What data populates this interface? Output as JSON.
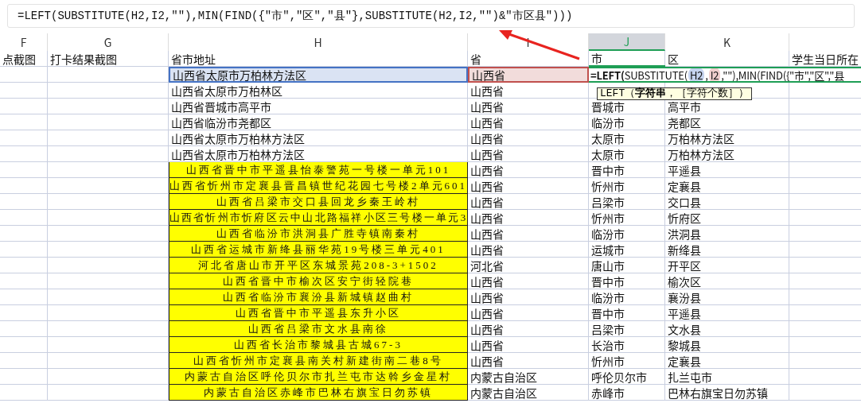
{
  "formula_bar": {
    "text": "=LEFT(SUBSTITUTE(H2,I2,\"\"),MIN(FIND({\"市\",\"区\",\"县\"},SUBSTITUTE(H2,I2,\"\")&\"市区县\")))"
  },
  "columns": [
    {
      "label": "F",
      "selected": false
    },
    {
      "label": "G",
      "selected": false
    },
    {
      "label": "H",
      "selected": false
    },
    {
      "label": "I",
      "selected": false
    },
    {
      "label": "J",
      "selected": true
    },
    {
      "label": "K",
      "selected": false
    }
  ],
  "header_row": [
    "点截图",
    "打卡结果截图",
    "省市地址",
    "省",
    "市",
    "区",
    "学生当日所在"
  ],
  "rows": [
    {
      "highlight": false,
      "editing": true,
      "cells": [
        {
          "text": "山西省太原市万柏林方法区",
          "color": "#4472c4"
        },
        {
          "text": "山西省",
          "color": "#c0504d"
        }
      ]
    },
    {
      "highlight": false,
      "editing": false,
      "cells": [
        {
          "text": "山西省太原市万柏林区"
        },
        {
          "text": "山西省"
        }
      ]
    },
    {
      "highlight": false,
      "editing": false,
      "cells": [
        {
          "text": "山西省晋城市高平市"
        },
        {
          "text": "山西省"
        },
        {
          "text": "晋城市"
        },
        {
          "text": "高平市"
        }
      ]
    },
    {
      "highlight": false,
      "editing": false,
      "cells": [
        {
          "text": "山西省临汾市尧都区"
        },
        {
          "text": "山西省"
        },
        {
          "text": "临汾市"
        },
        {
          "text": "尧都区"
        }
      ]
    },
    {
      "highlight": false,
      "editing": false,
      "cells": [
        {
          "text": "山西省太原市万柏林方法区"
        },
        {
          "text": "山西省"
        },
        {
          "text": "太原市"
        },
        {
          "text": "万柏林方法区"
        }
      ]
    },
    {
      "highlight": false,
      "editing": false,
      "cells": [
        {
          "text": "山西省太原市万柏林方法区"
        },
        {
          "text": "山西省"
        },
        {
          "text": "太原市"
        },
        {
          "text": "万柏林方法区"
        }
      ]
    },
    {
      "highlight": true,
      "editing": false,
      "cells": [
        {
          "text": "山西省晋中市平遥县怡泰警苑一号楼一单元101"
        },
        {
          "text": "山西省"
        },
        {
          "text": "晋中市"
        },
        {
          "text": "平遥县"
        }
      ]
    },
    {
      "highlight": true,
      "editing": false,
      "cells": [
        {
          "text": "山西省忻州市定襄县晋昌镇世纪花园七号楼2单元601"
        },
        {
          "text": "山西省"
        },
        {
          "text": "忻州市"
        },
        {
          "text": "定襄县"
        }
      ]
    },
    {
      "highlight": true,
      "editing": false,
      "cells": [
        {
          "text": "山西省吕梁市交口县回龙乡秦王岭村"
        },
        {
          "text": "山西省"
        },
        {
          "text": "吕梁市"
        },
        {
          "text": "交口县"
        }
      ]
    },
    {
      "highlight": true,
      "editing": false,
      "cells": [
        {
          "text": "山西省忻州市忻府区云中山北路福祥小区三号楼一单元3"
        },
        {
          "text": "山西省"
        },
        {
          "text": "忻州市"
        },
        {
          "text": "忻府区"
        }
      ]
    },
    {
      "highlight": true,
      "editing": false,
      "cells": [
        {
          "text": "山西省临汾市洪洞县广胜寺镇南秦村"
        },
        {
          "text": "山西省"
        },
        {
          "text": "临汾市"
        },
        {
          "text": "洪洞县"
        }
      ]
    },
    {
      "highlight": true,
      "editing": false,
      "cells": [
        {
          "text": "山西省运城市新绛县丽华苑19号楼三单元401"
        },
        {
          "text": "山西省"
        },
        {
          "text": "运城市"
        },
        {
          "text": "新绛县"
        }
      ]
    },
    {
      "highlight": true,
      "editing": false,
      "cells": [
        {
          "text": "河北省唐山市开平区东城景苑208-3+1502"
        },
        {
          "text": "河北省"
        },
        {
          "text": "唐山市"
        },
        {
          "text": "开平区"
        }
      ]
    },
    {
      "highlight": true,
      "editing": false,
      "cells": [
        {
          "text": "山西省晋中市榆次区安宁街轻院巷"
        },
        {
          "text": "山西省"
        },
        {
          "text": "晋中市"
        },
        {
          "text": "榆次区"
        }
      ]
    },
    {
      "highlight": true,
      "editing": false,
      "cells": [
        {
          "text": "山西省临汾市襄汾县新城镇赵曲村"
        },
        {
          "text": "山西省"
        },
        {
          "text": "临汾市"
        },
        {
          "text": "襄汾县"
        }
      ]
    },
    {
      "highlight": true,
      "editing": false,
      "cells": [
        {
          "text": "山西省晋中市平遥县东升小区"
        },
        {
          "text": "山西省"
        },
        {
          "text": "晋中市"
        },
        {
          "text": "平遥县"
        }
      ]
    },
    {
      "highlight": true,
      "editing": false,
      "cells": [
        {
          "text": "山西省吕梁市文水县南徐"
        },
        {
          "text": "山西省"
        },
        {
          "text": "吕梁市"
        },
        {
          "text": "文水县"
        }
      ]
    },
    {
      "highlight": true,
      "editing": false,
      "cells": [
        {
          "text": "山西省长治市黎城县古城67-3"
        },
        {
          "text": "山西省"
        },
        {
          "text": "长治市"
        },
        {
          "text": "黎城县"
        }
      ]
    },
    {
      "highlight": true,
      "editing": false,
      "cells": [
        {
          "text": "山西省忻州市定襄县南关村新建街南二巷8号"
        },
        {
          "text": "山西省"
        },
        {
          "text": "忻州市"
        },
        {
          "text": "定襄县"
        }
      ]
    },
    {
      "highlight": true,
      "editing": false,
      "cells": [
        {
          "text": "内蒙古自治区呼伦贝尔市扎兰屯市达斡乡金星村"
        },
        {
          "text": "内蒙古自治区"
        },
        {
          "text": "呼伦贝尔市"
        },
        {
          "text": "扎兰屯市"
        }
      ]
    },
    {
      "highlight": true,
      "editing": false,
      "cells": [
        {
          "text": "内蒙古自治区赤峰市巴林右旗宝日勿苏镇"
        },
        {
          "text": "内蒙古自治区"
        },
        {
          "text": "赤峰市"
        },
        {
          "text": "巴林右旗宝日勿苏镇"
        }
      ]
    }
  ],
  "editor": {
    "segments": [
      {
        "text": "=LEFT(",
        "kind": "bold"
      },
      {
        "text": "SUBSTITUTE(",
        "kind": "text"
      },
      {
        "text": "H2",
        "kind": "ref",
        "color": "#c5d3ee"
      },
      {
        "text": ",",
        "kind": "text"
      },
      {
        "text": "I2",
        "kind": "ref",
        "color": "#f0cfcd"
      },
      {
        "text": ",\"\"),MIN(FIND({\"市\",\"区\",\"县",
        "kind": "text"
      }
    ]
  },
  "tooltip": {
    "text": "LEFT（**字符串**，［字符个数］）"
  }
}
